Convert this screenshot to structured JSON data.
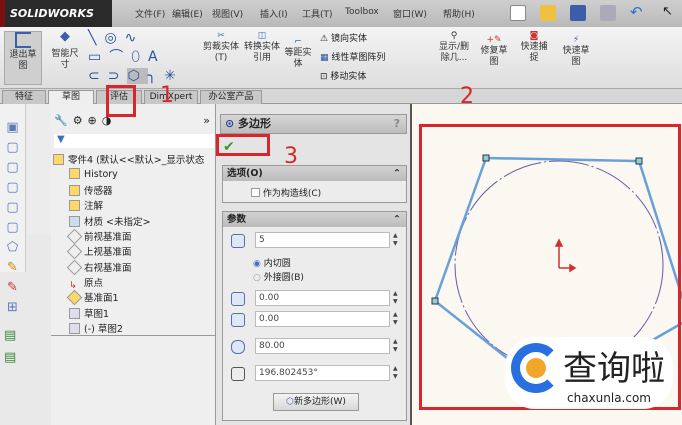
{
  "app": {
    "logo": "SOLIDWORKS"
  },
  "menu": [
    "文件(F)",
    "编辑(E)",
    "视图(V)",
    "插入(I)",
    "工具(T)",
    "Toolbox",
    "窗口(W)",
    "帮助(H)"
  ],
  "ribbon": {
    "exit_sketch": "退出草图",
    "smart_dim": "智能尺寸",
    "trim": "剪裁实体(T)",
    "convert": "转换实体引用",
    "offset": "等距实体",
    "mirror": "镜向实体",
    "linear_pattern": "线性草图阵列",
    "move": "移动实体",
    "show_delete": "显示/删除几...",
    "repair": "修复草图",
    "quick_snap": "快速捕捉",
    "rapid_sketch": "快速草图"
  },
  "tabs": [
    "特征",
    "草图",
    "评估",
    "DimXpert",
    "办公室产品"
  ],
  "annotations": {
    "n1": "1",
    "n2": "2",
    "n3": "3"
  },
  "tree": {
    "root": "零件4 (默认<<默认>_显示状态",
    "items": [
      "History",
      "传感器",
      "注解",
      "材质 <未指定>",
      "前视基准面",
      "上视基准面",
      "右视基准面",
      "原点",
      "基准面1",
      "草图1",
      "(-) 草图2"
    ]
  },
  "pm": {
    "title": "多边形",
    "help": "?",
    "options": {
      "header": "选项(O)",
      "construction": "作为构造线(C)",
      "construction_checked": false
    },
    "params": {
      "header": "参数",
      "sides": "5",
      "inscribed": "内切圆",
      "circumscribed": "外接圆(B)",
      "selected": "内切圆",
      "cx": "0.00",
      "cy": "0.00",
      "diameter": "80.00",
      "angle": "196.802453°",
      "new_polygon": "新多边形(W)"
    }
  },
  "watermark": {
    "brand": "查询啦",
    "url": "chaxunla.com"
  },
  "colors": {
    "accent_red": "#d8262c",
    "sketch_line": "#6aa0d8",
    "circle": "#6a5aa8"
  }
}
